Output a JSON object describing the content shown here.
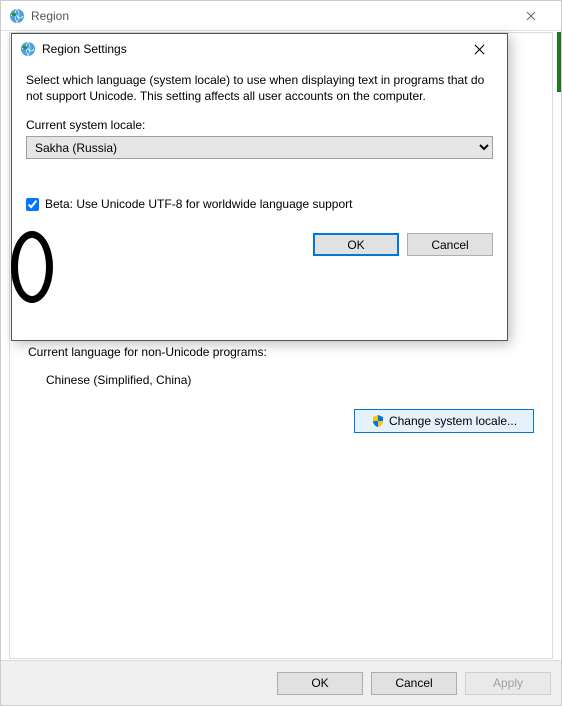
{
  "parent": {
    "title": "Region",
    "section_label": "Current language for non-Unicode programs:",
    "current_language": "Chinese (Simplified, China)",
    "change_locale_btn": "Change system locale...",
    "ok": "OK",
    "cancel": "Cancel",
    "apply": "Apply"
  },
  "modal": {
    "title": "Region Settings",
    "description": "Select which language (system locale) to use when displaying text in programs that do not support Unicode. This setting affects all user accounts on the computer.",
    "locale_label": "Current system locale:",
    "locale_value": "Sakha (Russia)",
    "utf8_label": "Beta: Use Unicode UTF-8 for worldwide language support",
    "ok": "OK",
    "cancel": "Cancel"
  }
}
